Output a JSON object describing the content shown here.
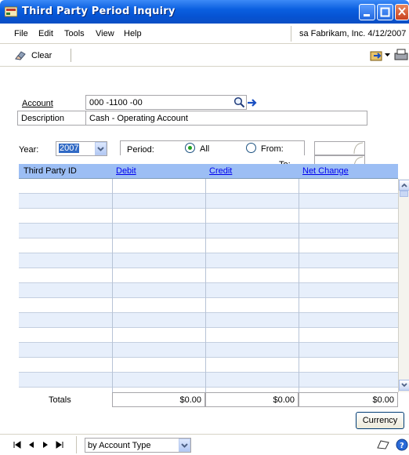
{
  "window": {
    "title": "Third Party Period Inquiry"
  },
  "menu": [
    {
      "label": "File",
      "key": "F"
    },
    {
      "label": "Edit",
      "key": "E"
    },
    {
      "label": "Tools",
      "key": "T"
    },
    {
      "label": "View",
      "key": "V"
    },
    {
      "label": "Help",
      "key": "H"
    }
  ],
  "session": {
    "text": "sa  Fabrikam, Inc.  4/12/2007"
  },
  "toolbar": {
    "clear_label": "Clear"
  },
  "form": {
    "account_label": "Account",
    "account_value": "000 -1100 -00",
    "description_label": "Description",
    "description_value": "Cash - Operating Account",
    "year_label": "Year:",
    "year_value": "2007",
    "period_label": "Period:",
    "all_label": "All",
    "from_label": "From:",
    "to_label": "To:",
    "period_selected": "All"
  },
  "grid": {
    "columns": [
      "Third Party ID",
      "Debit",
      "Credit",
      "Net Change"
    ],
    "rows": 14,
    "totals_label": "Totals",
    "totals": [
      "$0.00",
      "$0.00",
      "$0.00"
    ]
  },
  "buttons": {
    "currency": "Currency"
  },
  "status": {
    "sort_by": "by Account Type"
  }
}
